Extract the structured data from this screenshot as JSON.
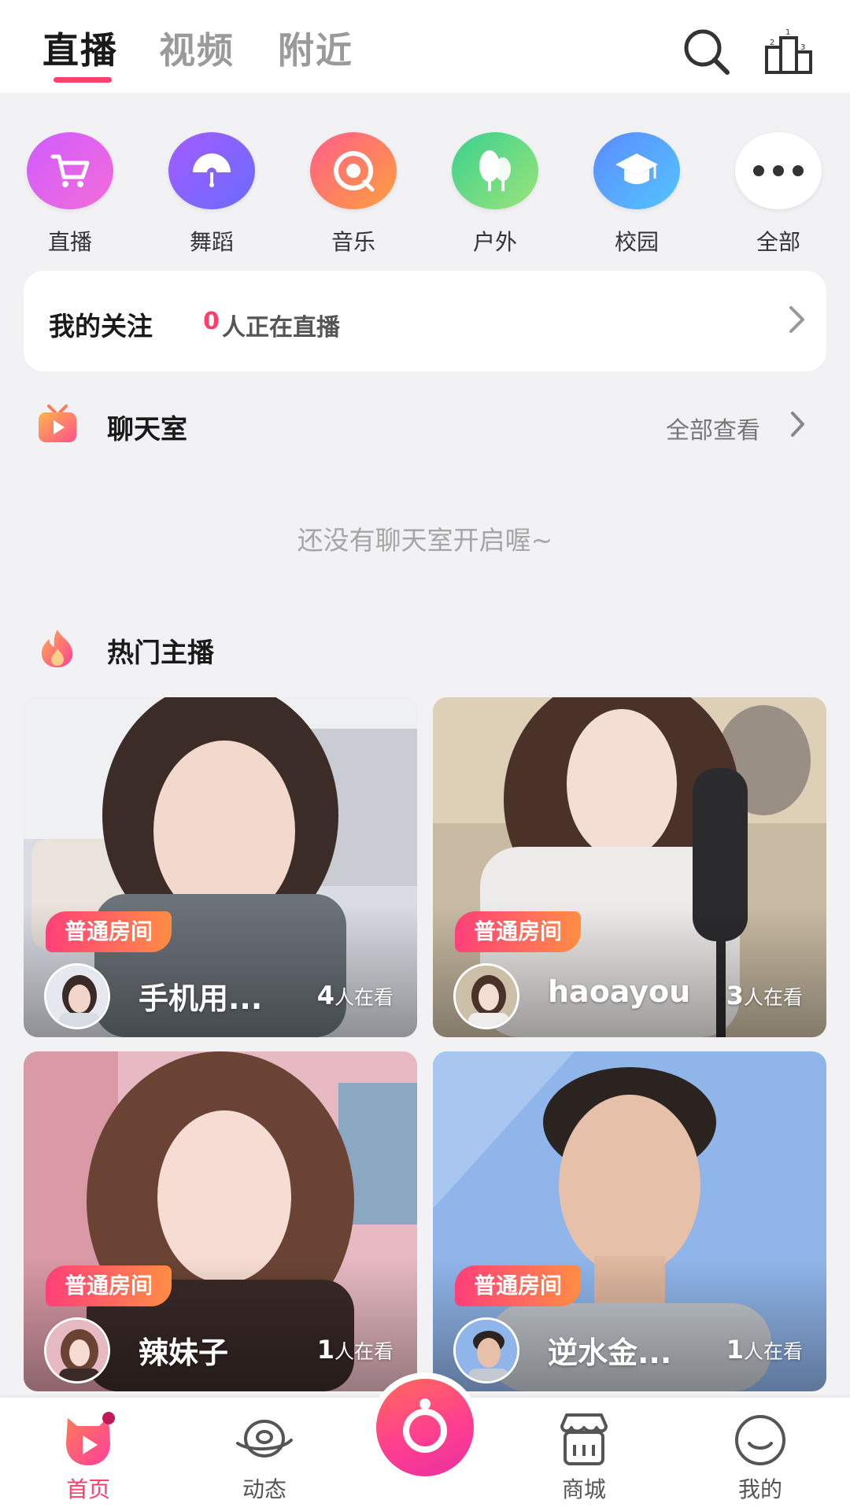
{
  "header": {
    "tabs": [
      {
        "label": "直播",
        "active": true
      },
      {
        "label": "视频",
        "active": false
      },
      {
        "label": "附近",
        "active": false
      }
    ],
    "icons": [
      "search-icon",
      "ranking-icon"
    ]
  },
  "categories": [
    {
      "label": "直播",
      "icon": "cart-icon",
      "color_from": "#d05cff",
      "color_to": "#f36cd8"
    },
    {
      "label": "舞蹈",
      "icon": "fan-icon",
      "color_from": "#a45bff",
      "color_to": "#6a6bff"
    },
    {
      "label": "音乐",
      "icon": "vinyl-icon",
      "color_from": "#ff5e8a",
      "color_to": "#ff9f3f"
    },
    {
      "label": "户外",
      "icon": "tree-icon",
      "color_from": "#3ad18f",
      "color_to": "#9be47a"
    },
    {
      "label": "校园",
      "icon": "graduation-cap-icon",
      "color_from": "#5b8bff",
      "color_to": "#55c4ff"
    },
    {
      "label": "全部",
      "icon": "more-dots-icon",
      "color_from": "#ffffff",
      "color_to": "#ffffff"
    }
  ],
  "follow": {
    "title": "我的关注",
    "count": "0",
    "text": "人正在直播"
  },
  "chat_room": {
    "title": "聊天室",
    "see_all": "全部查看",
    "empty": "还没有聊天室开启喔~"
  },
  "hot": {
    "title": "热门主播",
    "cards": [
      {
        "badge": "普通房间",
        "name": "手机用...",
        "viewers": "4",
        "viewers_label": "人在看"
      },
      {
        "badge": "普通房间",
        "name": "haoayou",
        "viewers": "3",
        "viewers_label": "人在看"
      },
      {
        "badge": "普通房间",
        "name": "辣妹子",
        "viewers": "1",
        "viewers_label": "人在看"
      },
      {
        "badge": "普通房间",
        "name": "逆水金...",
        "viewers": "1",
        "viewers_label": "人在看"
      }
    ]
  },
  "nav": {
    "items": [
      {
        "label": "首页",
        "active": true
      },
      {
        "label": "动态",
        "active": false
      },
      {
        "label": "商城",
        "active": false
      },
      {
        "label": "我的",
        "active": false
      }
    ]
  },
  "colors": {
    "accent": "#ff3f6c",
    "badge_from": "#ff3f7a",
    "badge_to": "#ff8d44"
  }
}
